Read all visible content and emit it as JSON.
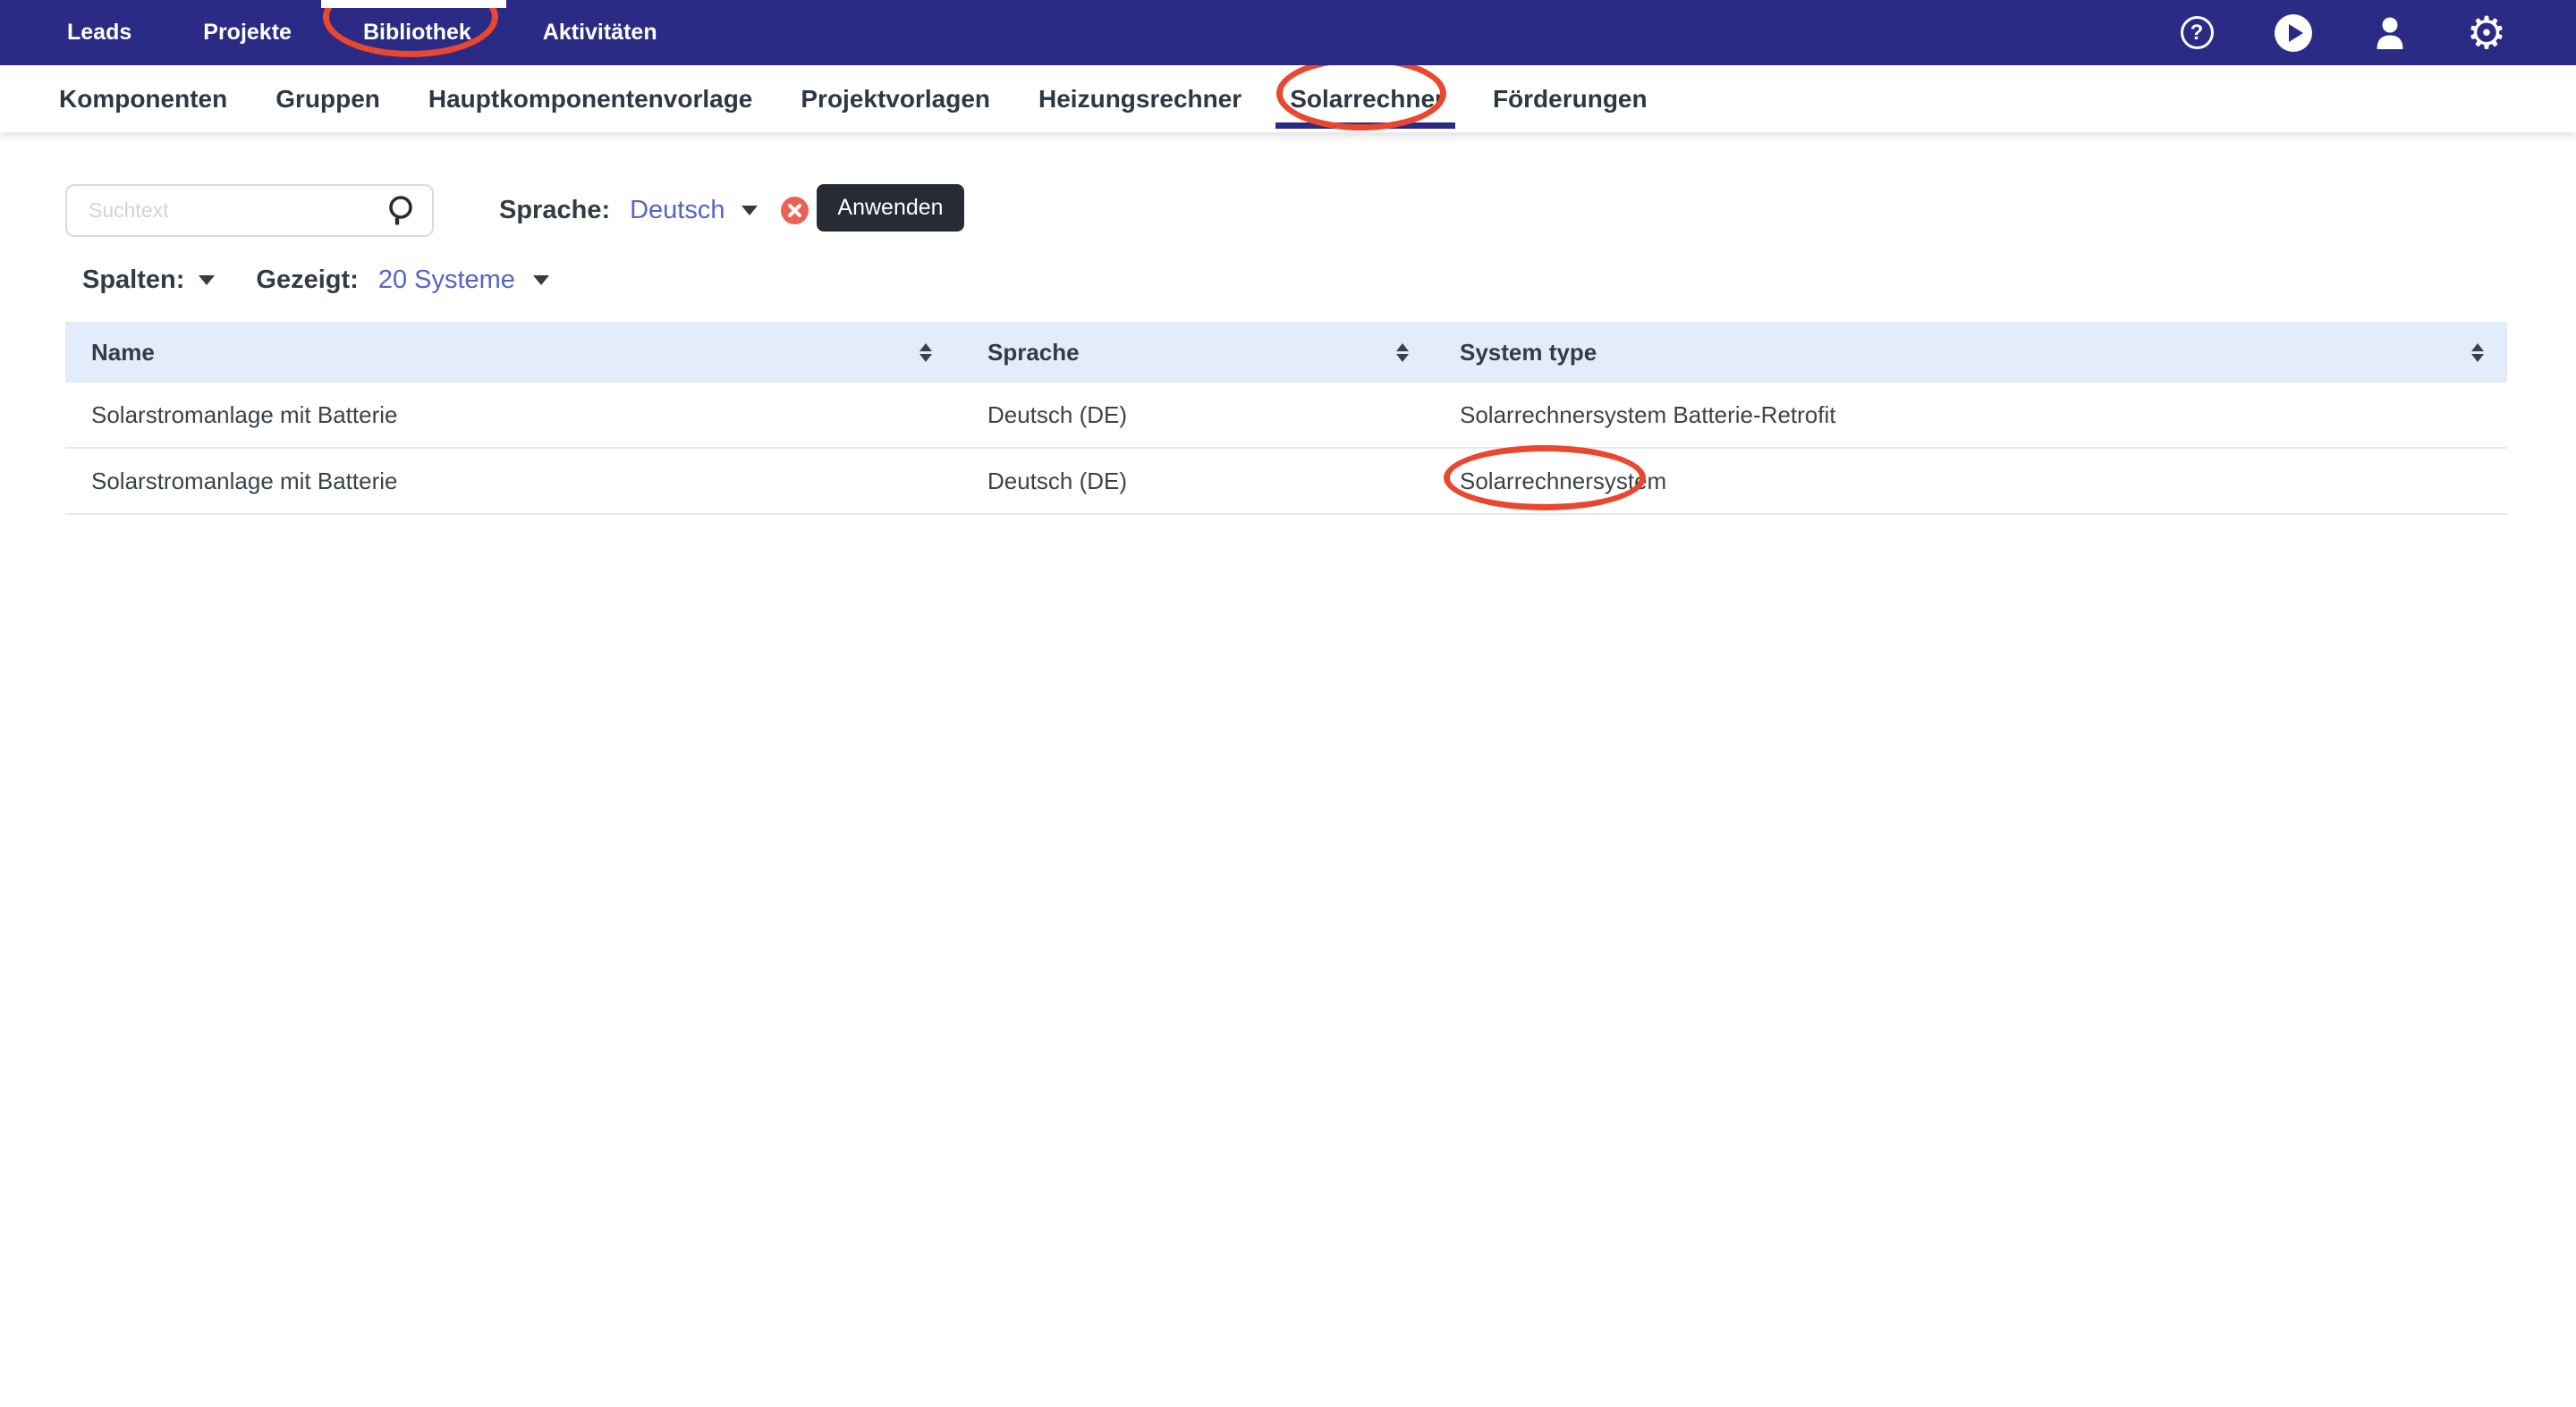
{
  "nav": {
    "items": [
      {
        "label": "Leads"
      },
      {
        "label": "Projekte"
      },
      {
        "label": "Bibliothek"
      },
      {
        "label": "Aktivitäten"
      }
    ],
    "help_glyph": "?"
  },
  "tabs": [
    {
      "label": "Komponenten",
      "active": false
    },
    {
      "label": "Gruppen",
      "active": false
    },
    {
      "label": "Hauptkomponentenvorlage",
      "active": false
    },
    {
      "label": "Projektvorlagen",
      "active": false
    },
    {
      "label": "Heizungsrechner",
      "active": false
    },
    {
      "label": "Solarrechner",
      "active": true
    },
    {
      "label": "Förderungen",
      "active": false
    }
  ],
  "filters": {
    "search_placeholder": "Suchtext",
    "language_label": "Sprache:",
    "language_value": "Deutsch",
    "apply_label": "Anwenden",
    "columns_label": "Spalten:",
    "shown_label": "Gezeigt:",
    "shown_value": "20 Systeme"
  },
  "table": {
    "columns": [
      {
        "label": "Name"
      },
      {
        "label": "Sprache"
      },
      {
        "label": "System type"
      }
    ],
    "rows": [
      {
        "name": "Solarstromanlage mit Batterie",
        "sprache": "Deutsch (DE)",
        "system_type": "Solarrechnersystem Batterie-Retrofit"
      },
      {
        "name": "Solarstromanlage mit Batterie",
        "sprache": "Deutsch (DE)",
        "system_type": "Solarrechnersystem"
      }
    ]
  },
  "annotations": {
    "circled_items": [
      "Bibliothek",
      "Solarrechner",
      "Solarrechnersystem"
    ]
  },
  "colors": {
    "nav_bg": "#2b2b86",
    "tab_text": "#2d3844",
    "link": "#5664c4",
    "annotation_red": "#e9472e",
    "clear_badge_red": "#ec6153",
    "apply_button_bg": "#272c34",
    "table_header_bg": "#e3ecfb",
    "body_text": "#3a434c",
    "separator": "#e7e9eb"
  }
}
